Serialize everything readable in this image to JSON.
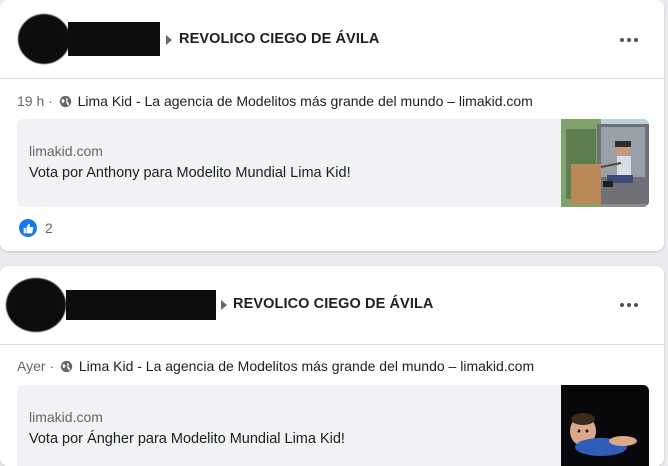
{
  "posts": [
    {
      "group_name": "REVOLICO CIEGO DE ÁVILA",
      "time": "19 h",
      "separator": "·",
      "link_title_line": "Lima Kid - La agencia de Modelitos más grande del mundo – limakid.com",
      "link": {
        "domain": "limakid.com",
        "title": "Vota por Anthony para Modelito Mundial Lima Kid!"
      },
      "reactions_count": "2"
    },
    {
      "group_name": "REVOLICO CIEGO DE ÁVILA",
      "time": "Ayer",
      "separator": "·",
      "link_title_line": "Lima Kid - La agencia de Modelitos más grande del mundo – limakid.com",
      "link": {
        "domain": "limakid.com",
        "title": "Vota por Ángher para Modelito Mundial Lima Kid!"
      }
    }
  ],
  "icons": {
    "more": "more-horizontal-icon",
    "globe": "globe-icon",
    "like": "like-icon",
    "caret": "caret-right-icon"
  },
  "colors": {
    "like_blue": "#1877f2",
    "card_bg": "#ffffff",
    "page_bg": "#e9ebee",
    "secondary_text": "#65676b"
  }
}
